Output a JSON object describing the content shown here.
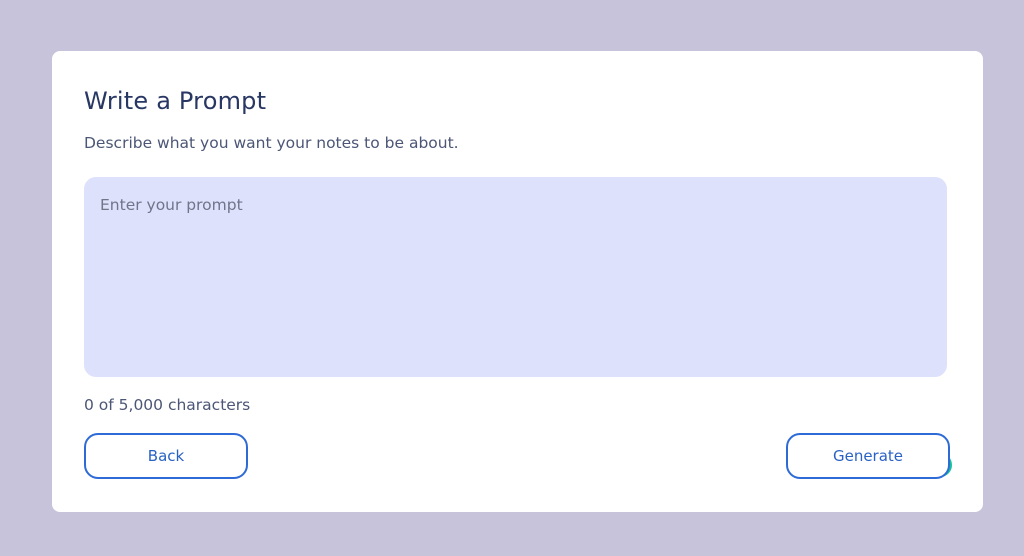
{
  "header": {
    "title": "Write a Prompt",
    "subtitle": "Describe what you want your notes to be about."
  },
  "prompt": {
    "value": "",
    "placeholder": "Enter your prompt"
  },
  "counter": {
    "text": "0 of 5,000 characters"
  },
  "actions": {
    "back_label": "Back",
    "generate_label": "Generate"
  },
  "icons": {
    "grammarly": "grammarly-icon"
  },
  "colors": {
    "background": "#c6c3da",
    "accent": "#2e6bd6",
    "input_background": "#dde1fb",
    "title": "#283763",
    "grammarly": "#15c39a"
  }
}
